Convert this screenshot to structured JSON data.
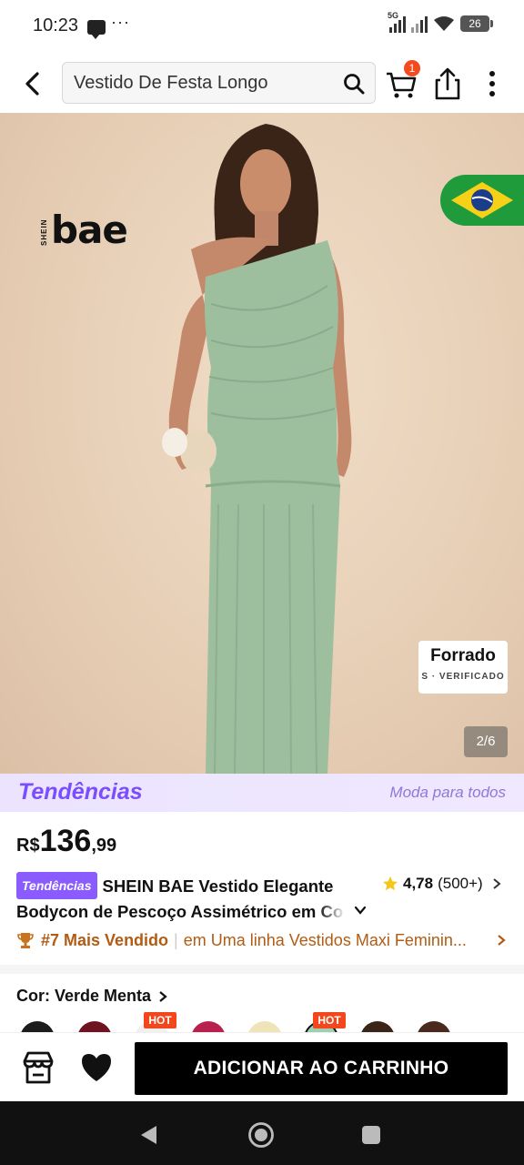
{
  "status": {
    "time": "10:23",
    "network": "5G",
    "battery": "26"
  },
  "nav": {
    "search_value": "Vestido De Festa Longo",
    "cart_count": "1"
  },
  "hero": {
    "brand_small": "SHEIN",
    "brand_big": "bae",
    "badge_title": "Forrado",
    "badge_sub": "S · VERIFICADO",
    "page_counter": "2/6"
  },
  "trend_banner": {
    "logo": "Tendências",
    "tagline": "Moda para todos"
  },
  "product": {
    "currency": "R$",
    "price_int": "136",
    "price_cents": ",99",
    "trend_pill": "Tendências",
    "title_line1": "SHEIN BAE Vestido Elegante",
    "title_line2": "Bodycon de Pescoço Assimétrico em Co",
    "rating_score": "4,78",
    "rating_count": "(500+)"
  },
  "bestseller": {
    "rank": "#7 Mais Vendido",
    "category": "em Uma linha Vestidos Maxi Feminin..."
  },
  "color": {
    "label": "Cor: Verde Menta",
    "hot_label": "HOT",
    "swatches": [
      "#1c1c1c",
      "#6e1420",
      "#f1f1f1",
      "#b8204e",
      "#efe3b8",
      "#9ccfb4",
      "#3b2418",
      "#4a2a1e"
    ]
  },
  "actions": {
    "add_to_cart": "ADICIONAR AO CARRINHO"
  },
  "colors": {
    "accent_purple": "#7a4dff",
    "bestseller_orange": "#b25c13",
    "hot_red": "#f2471d",
    "dress_green": "#9dbf9e"
  }
}
